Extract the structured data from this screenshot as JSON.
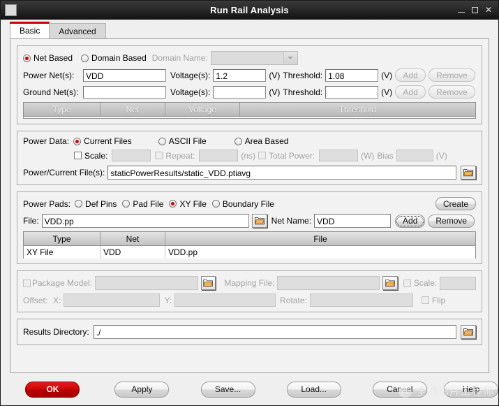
{
  "window": {
    "title": "Run Rail Analysis",
    "icon": "window-icon",
    "controls": {
      "minimize": "—",
      "maximize": "□",
      "close": "✕"
    }
  },
  "tabs": [
    {
      "label": "Basic",
      "active": true
    },
    {
      "label": "Advanced",
      "active": false
    }
  ],
  "net_group": {
    "net_based_label": "Net Based",
    "net_based_selected": true,
    "domain_based_label": "Domain Based",
    "domain_based_selected": false,
    "domain_name_label": "Domain Name:",
    "domain_name_value": "",
    "power_net_label": "Power Net(s):",
    "power_net_value": "VDD",
    "power_voltage_label": "Voltage(s):",
    "power_voltage_value": "1.2",
    "power_v_unit": "(V)",
    "power_threshold_label": "Threshold:",
    "power_threshold_value": "1.08",
    "power_thr_unit": "(V)",
    "power_add": "Add",
    "power_remove": "Remove",
    "ground_net_label": "Ground Net(s):",
    "ground_net_value": "",
    "ground_voltage_label": "Voltage(s):",
    "ground_voltage_value": "",
    "ground_v_unit": "(V)",
    "ground_threshold_label": "Threshold:",
    "ground_threshold_value": "",
    "ground_thr_unit": "(V)",
    "ground_add": "Add",
    "ground_remove": "Remove",
    "table": {
      "headers": [
        "Type",
        "Net",
        "Voltage",
        "Threshold"
      ],
      "rows": []
    }
  },
  "power_data": {
    "label": "Power Data:",
    "current_files_label": "Current Files",
    "current_files_selected": true,
    "ascii_file_label": "ASCII File",
    "area_based_label": "Area Based",
    "scale_label": "Scale:",
    "scale_value": "",
    "repeat_label": "Repeat:",
    "repeat_value": "",
    "ns_unit": "(ns)",
    "total_power_label": "Total Power:",
    "total_power_value": "",
    "w_unit": "(W)",
    "bias_label": "Bias",
    "bias_value": "",
    "bias_unit": "(V)",
    "file_label": "Power/Current File(s):",
    "file_value": "staticPowerResults/static_VDD.ptiavg",
    "browse_icon": "folder-icon"
  },
  "power_pads": {
    "label": "Power Pads:",
    "def_pins_label": "Def Pins",
    "pad_file_label": "Pad File",
    "xy_file_label": "XY File",
    "xy_file_selected": true,
    "boundary_file_label": "Boundary File",
    "create_label": "Create",
    "file_label": "File:",
    "file_value": "VDD.pp",
    "browse_icon": "folder-icon",
    "net_name_label": "Net Name:",
    "net_name_value": "VDD",
    "add_label": "Add",
    "remove_label": "Remove",
    "table": {
      "headers": [
        "Type",
        "Net",
        "File"
      ],
      "rows": [
        {
          "type": "XY File",
          "net": "VDD",
          "file": "VDD.pp"
        }
      ]
    }
  },
  "package": {
    "package_model_label": "Package Model:",
    "package_model_value": "",
    "package_browse_icon": "folder-icon",
    "mapping_file_label": "Mapping File:",
    "mapping_file_value": "",
    "mapping_browse_icon": "folder-icon",
    "scale_label": "Scale:",
    "scale_value": "",
    "offset_label": "Offset:",
    "offset_x_label": "X:",
    "offset_x_value": "",
    "offset_y_label": "Y:",
    "offset_y_value": "",
    "rotate_label": "Rotate:",
    "rotate_value": "",
    "flip_label": "Flip"
  },
  "results": {
    "label": "Results Directory:",
    "value": "./",
    "browse_icon": "folder-icon"
  },
  "buttons": {
    "ok": "OK",
    "apply": "Apply",
    "save": "Save...",
    "load": "Load...",
    "cancel": "Cancel",
    "help": "Help"
  },
  "watermark": {
    "text": "全栈芯片工程师",
    "logo": "wechat-logo-icon"
  },
  "colors": {
    "accent_red": "#cc0000",
    "titlebar": "#242424",
    "panel": "#f2f2f2"
  }
}
